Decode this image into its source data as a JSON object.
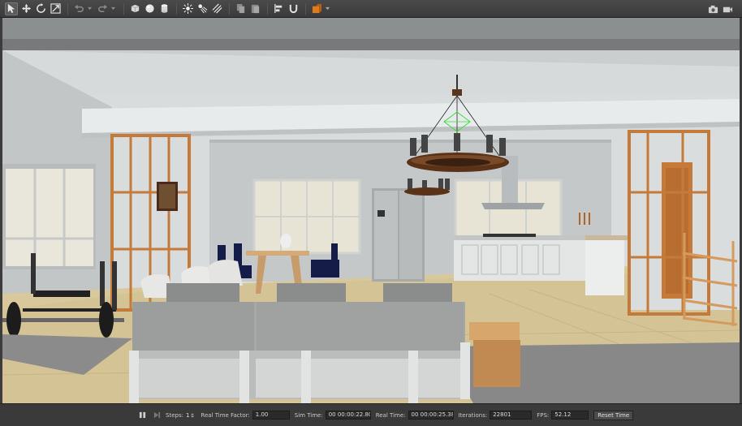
{
  "toolbar": {
    "left_icons": [
      "select-arrow-icon",
      "translate-icon",
      "rotate-icon",
      "scale-icon",
      "undo-icon",
      "redo-icon",
      "box-shape-icon",
      "sphere-shape-icon",
      "cylinder-shape-icon",
      "point-light-icon",
      "spot-light-icon",
      "directional-light-icon",
      "copy-icon",
      "paste-icon",
      "align-icon",
      "snap-icon",
      "change-view-icon"
    ],
    "right_icons": [
      "screenshot-icon",
      "record-video-icon"
    ]
  },
  "statusbar": {
    "steps_label": "Steps:",
    "steps_value": "1",
    "rtf_label": "Real Time Factor:",
    "rtf_value": "1.00",
    "sim_time_label": "Sim Time:",
    "sim_time_value": "00 00:00:22.801",
    "real_time_label": "Real Time:",
    "real_time_value": "00 00:00:25.388",
    "iterations_label": "Iterations:",
    "iterations_value": "22801",
    "fps_label": "FPS:",
    "fps_value": "52.12",
    "reset_label": "Reset Time"
  },
  "colors": {
    "toolbar_bg": "#3f3f3f",
    "accent_orange": "#e07a1f",
    "floor_wood": "#d8c79a",
    "rug": "#8a8a8a",
    "wall": "#d9dcdc"
  }
}
